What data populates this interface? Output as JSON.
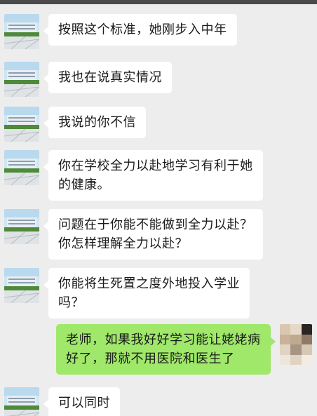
{
  "colors": {
    "background": "#ededed",
    "incoming_bubble": "#ffffff",
    "outgoing_bubble": "#9fe86a",
    "text": "#1a1a1a"
  },
  "messages": [
    {
      "side": "left",
      "text": "按照这个标准，她刚步入中年"
    },
    {
      "side": "left",
      "text": "我也在说真实情况"
    },
    {
      "side": "left",
      "text": "我说的你不信"
    },
    {
      "side": "left",
      "text": "你在学校全力以赴地学习有利于她\n的健康。"
    },
    {
      "side": "left",
      "text": "问题在于你能不能做到全力以赴？\n你怎样理解全力以赴？"
    },
    {
      "side": "left",
      "text": "你能将生死置之度外地投入学业\n吗？"
    },
    {
      "side": "right",
      "text": "老师，如果我好好学习能让姥姥病\n好了，那就不用医院和医生了"
    },
    {
      "side": "left",
      "text": "可以同时"
    }
  ],
  "avatars": {
    "teacher": "school-building-photo",
    "student": "pixelated-mosaic-photo"
  }
}
